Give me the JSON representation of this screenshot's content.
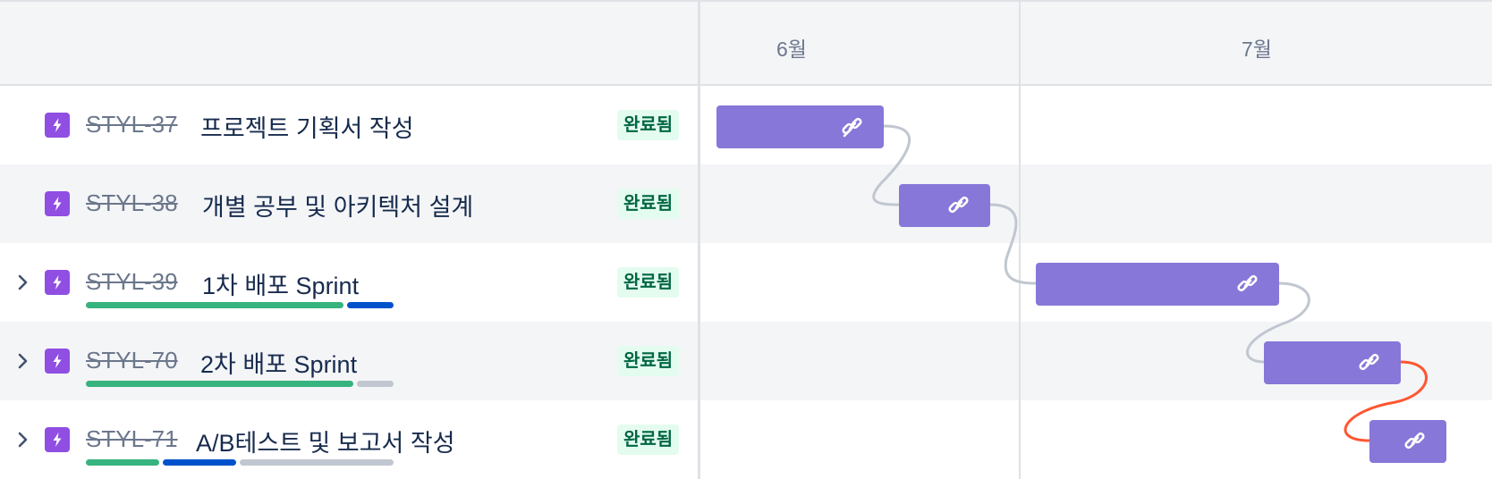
{
  "timeline": {
    "months": [
      "6월",
      "7월"
    ]
  },
  "issues": [
    {
      "key": "STYL-37",
      "summary": "프로젝트 기획서 작성",
      "status": "완료됨",
      "expandable": false,
      "progress": null
    },
    {
      "key": "STYL-38",
      "summary": "개별 공부 및 아키텍처 설계",
      "status": "완료됨",
      "expandable": false,
      "progress": null
    },
    {
      "key": "STYL-39",
      "summary": "1차 배포 Sprint",
      "status": "완료됨",
      "expandable": true,
      "progress": {
        "done": 0.85,
        "in_progress": 0.15,
        "todo": 0.0
      }
    },
    {
      "key": "STYL-70",
      "summary": "2차 배포 Sprint",
      "status": "완료됨",
      "expandable": true,
      "progress": {
        "done": 0.88,
        "in_progress": 0.0,
        "todo": 0.12
      }
    },
    {
      "key": "STYL-71",
      "summary": "A/B테스트 및 보고서 작성",
      "status": "완료됨",
      "expandable": true,
      "progress": {
        "done": 0.25,
        "in_progress": 0.25,
        "todo": 0.5
      }
    }
  ],
  "icons": {
    "issue_type": "epic-lightning-icon",
    "bar_link": "link-icon",
    "expand": "chevron-right-icon"
  },
  "colors": {
    "epic_purple": "#904ee2",
    "bar_purple": "#8777d9",
    "status_bg": "#e3fcef",
    "status_text": "#006644",
    "progress_done": "#36b37e",
    "progress_in_progress": "#0052cc",
    "progress_todo": "#c1c7d0",
    "dependency_ok": "#c1c7d0",
    "dependency_conflict": "#ff5630"
  }
}
